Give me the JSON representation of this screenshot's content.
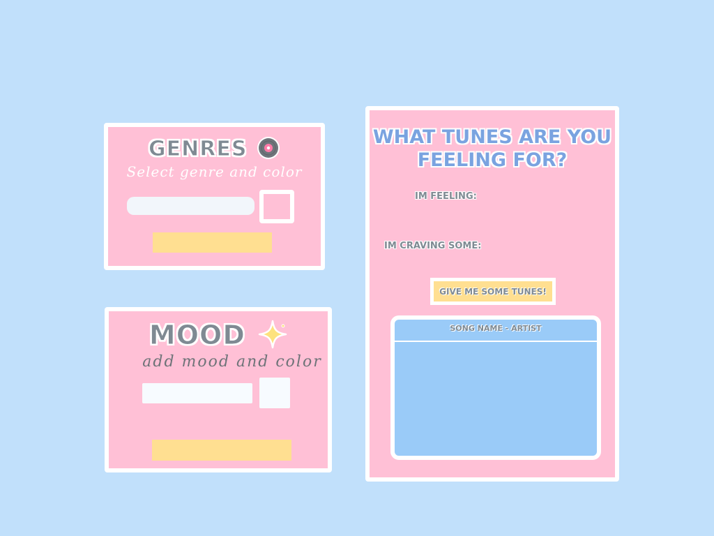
{
  "genres": {
    "title": "GENRES",
    "subtitle": "Select genre and color",
    "input_placeholder": "",
    "submit_label": ""
  },
  "mood": {
    "title": "MOOD",
    "subtitle": "add mood and color",
    "input_placeholder": "",
    "submit_label": ""
  },
  "tunes": {
    "title": "WHAT TUNES ARE YOU FEELING FOR?",
    "feeling_label": "IM FEELING:",
    "craving_label": "IM CRAVING SOME:",
    "button_label": "GIVE ME SOME TUNES!",
    "player_header": "SONG NAME - ARTIST"
  },
  "colors": {
    "background": "#c1e0fb",
    "card": "#ffc0d6",
    "button": "#ffdf91",
    "player": "#9acbf8",
    "title_blue": "#7aa3e0",
    "text_gray": "#7f8a93"
  },
  "icons": {
    "genres": "vinyl-record-icon",
    "mood": "sparkle-icon"
  }
}
